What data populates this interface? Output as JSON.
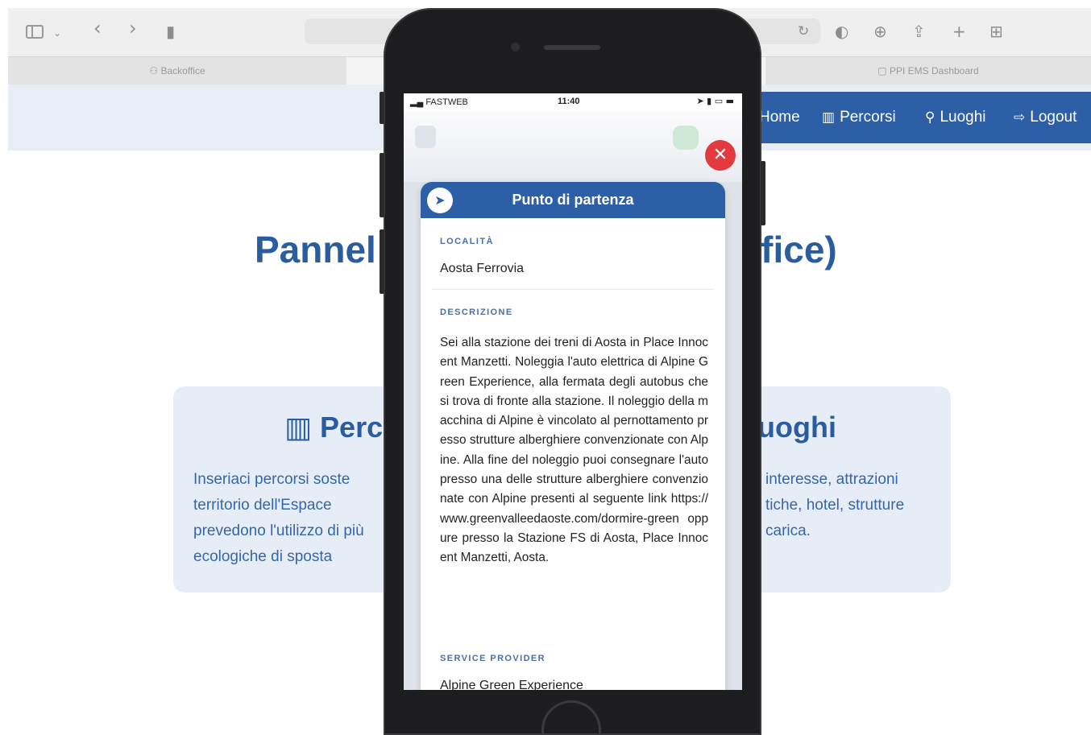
{
  "browser": {
    "tabs": [
      {
        "label": "Backoffice",
        "icon": "person-icon"
      },
      {
        "label": "",
        "icon": ""
      },
      {
        "label": "PPI EMS Dashboard",
        "icon": "square-icon"
      }
    ]
  },
  "nav": {
    "links": [
      {
        "label": "Home",
        "icon": "home-icon"
      },
      {
        "label": "Percorsi",
        "icon": "map-icon"
      },
      {
        "label": "Luoghi",
        "icon": "map-pin-icon"
      },
      {
        "label": "Logout",
        "icon": "logout-icon"
      }
    ]
  },
  "page": {
    "title_left": "Pannel",
    "title_right": "ffice)"
  },
  "cards": {
    "left": {
      "title": "Perc",
      "text": "Inseriaci percorsi soste territorio dell'Espace prevedono l'utilizzo di più ecologiche di sposta"
    },
    "right": {
      "title": "uoghi",
      "text": "interesse, attrazioni tiche, hotel, strutture carica."
    }
  },
  "phone": {
    "status": {
      "carrier": "FASTWEB",
      "time": "11:40"
    },
    "modal": {
      "title": "Punto di partenza",
      "location_label": "LOCALITÀ",
      "location_value": "Aosta Ferrovia",
      "description_label": "DESCRIZIONE",
      "description": "Sei alla stazione dei treni di Aosta in Place Innocent Manzetti. Noleggia l'auto elettrica di Alpine Green Experience, alla fermata degli autobus che si trova di fronte alla stazione. Il noleggio della macchina di Alpine è vincolato al pernottamento presso strutture alberghiere convenzionate con Alpine. Alla fine del noleggio puoi consegnare l'auto presso una delle strutture alberghiere convenzionate con Alpine presenti al seguente link https://www.greenvalleedaoste.com/dormire-green oppure presso la Stazione FS di Aosta, Place Innocent Manzetti, Aosta.",
      "provider_label": "SERVICE PROVIDER",
      "provider_value": "Alpine Green Experience"
    }
  },
  "colors": {
    "brand": "#2c5fa5",
    "close": "#e23a3f"
  }
}
